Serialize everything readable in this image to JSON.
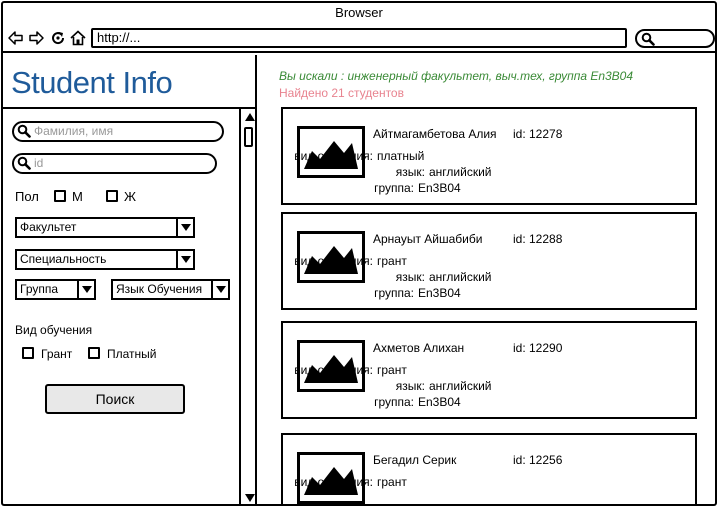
{
  "browser": {
    "title": "Browser",
    "url": "http://...",
    "icons": [
      "back-arrow-icon",
      "forward-arrow-icon",
      "reload-icon",
      "home-icon",
      "search-icon"
    ]
  },
  "app": {
    "title": "Student Info",
    "title_color": "#1f5b9a"
  },
  "filters": {
    "name_placeholder": "Фамилия, имя",
    "id_placeholder": "id",
    "gender_label": "Пол",
    "gender_m": "М",
    "gender_f": "Ж",
    "faculty": "Факультет",
    "specialty": "Специальность",
    "group": "Группа",
    "language": "Язык Обучения",
    "study_type_label": "Вид обучения",
    "grant": "Грант",
    "paid": "Платный",
    "search_button": "Поиск"
  },
  "results": {
    "query_text": "Вы искали : инженерный факультет, выч.тех, группа En3B04",
    "found_text": "Найдено 21 студентов",
    "query_color": "#3a8a36",
    "found_color": "#e8838f",
    "labels": {
      "study_type": "вид обучения:",
      "language": "язык:",
      "group": "группа:"
    },
    "cards": [
      {
        "name": "Айтмагамбетова Алия",
        "id": "id: 12278",
        "study_type": "платный",
        "language": "английский",
        "group": "En3B04"
      },
      {
        "name": "Арнауыт Айшабиби",
        "id": "id: 12288",
        "study_type": "грант",
        "language": "английский",
        "group": "En3B04"
      },
      {
        "name": "Ахметов Алихан",
        "id": "id: 12290",
        "study_type": "грант",
        "language": "английский",
        "group": "En3B04"
      },
      {
        "name": "Бегадил Серик",
        "id": "id: 12256",
        "study_type": "грант"
      }
    ]
  }
}
